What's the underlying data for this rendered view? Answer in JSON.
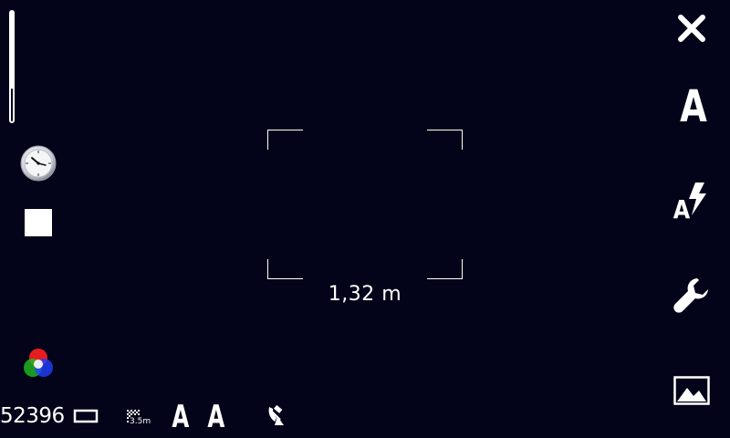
{
  "viewfinder": {
    "focus_distance": "1,32 m",
    "zoom_level": 0.3
  },
  "status_bar": {
    "shot_count": "52396",
    "iso_label": "A",
    "white_balance_label": "A",
    "resolution_label": "3.5m"
  },
  "toolbar": {
    "scene_label": "A",
    "flash_label": "A"
  },
  "icons": {
    "clock": "clock-icon",
    "stop": "stop-square-icon",
    "color": "color-wheel-icon",
    "aspect": "aspect-ratio-icon",
    "resolution": "resolution-icon",
    "gps": "gps-satellite-icon",
    "close": "close-icon",
    "flash": "flash-auto-icon",
    "settings": "wrench-icon",
    "gallery": "gallery-icon"
  }
}
